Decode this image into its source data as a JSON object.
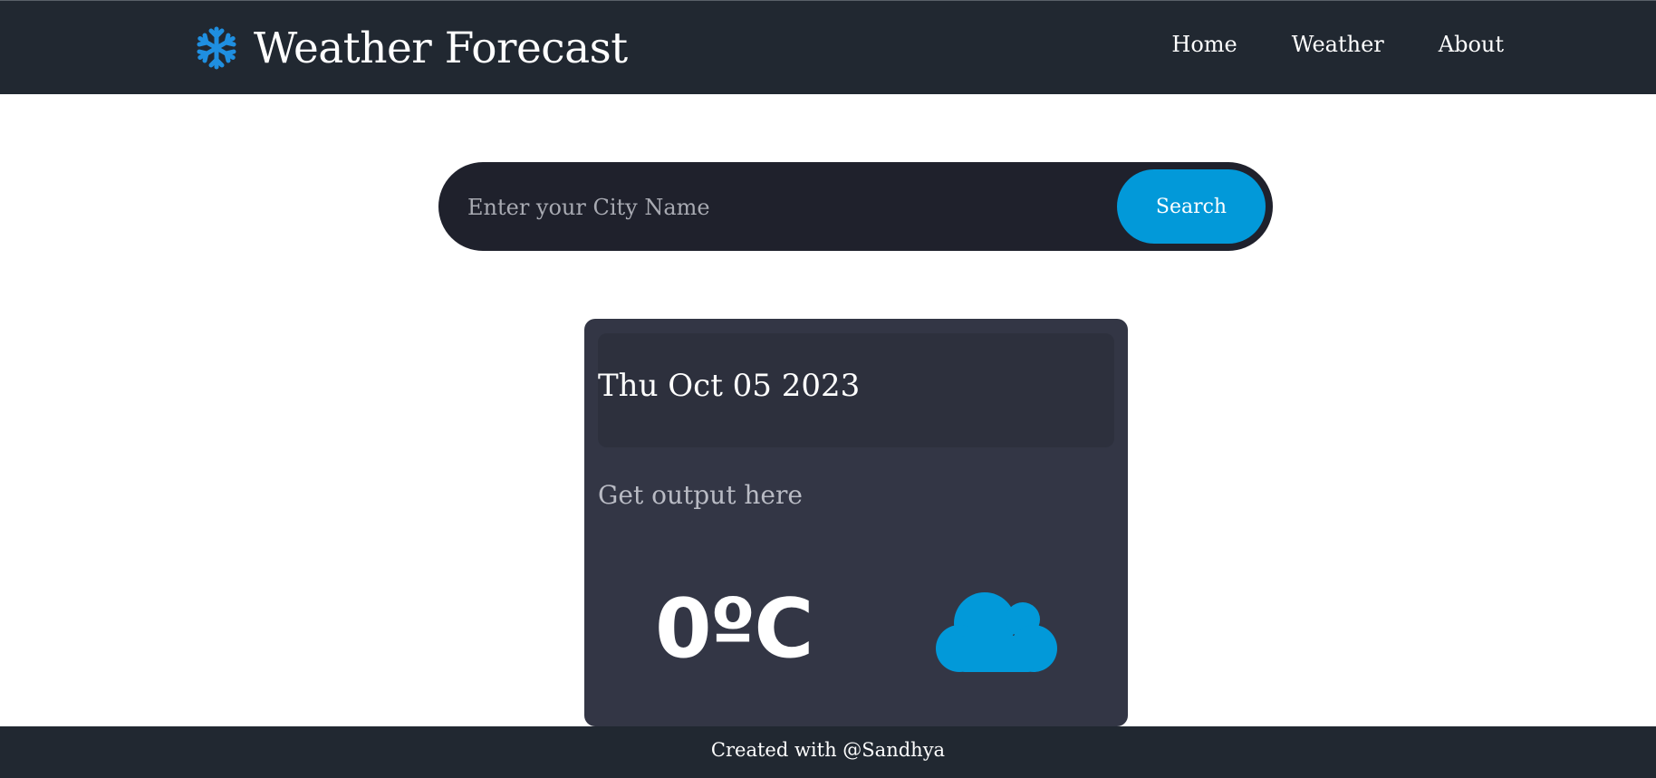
{
  "header": {
    "brand_icon": "snowflake-icon",
    "title": "Weather Forecast",
    "nav": [
      {
        "label": "Home"
      },
      {
        "label": "Weather"
      },
      {
        "label": "About"
      }
    ]
  },
  "search": {
    "placeholder": "Enter your City Name",
    "value": "",
    "button_label": "Search"
  },
  "card": {
    "date": "Thu Oct 05 2023",
    "output": "Get output here",
    "temperature": "0ºC",
    "weather_icon": "cloud-icon"
  },
  "footer": {
    "text": "Created with @Sandhya"
  },
  "colors": {
    "nav_bg": "#212831",
    "accent": "#0299d9",
    "search_bg": "#1f212c",
    "card_bg": "#333645",
    "date_bg": "#2d303d"
  }
}
